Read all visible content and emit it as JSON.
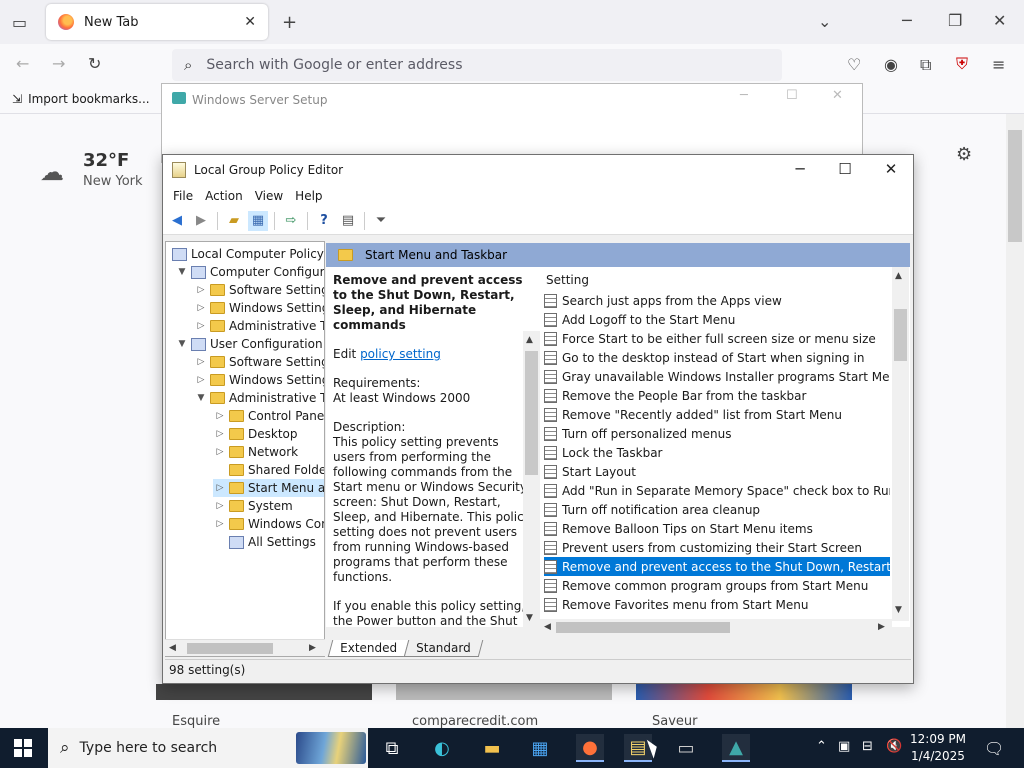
{
  "browser": {
    "tab_title": "New Tab",
    "url_placeholder": "Search with Google or enter address",
    "bookmark_import": "Import bookmarks...",
    "weather": {
      "temp": "32°F",
      "city": "New York"
    },
    "tiles": [
      "Esquire",
      "comparecredit.com",
      "Saveur"
    ]
  },
  "setup_window": {
    "title": "Windows Server Setup"
  },
  "gpe": {
    "title": "Local Group Policy Editor",
    "menu": [
      "File",
      "Action",
      "View",
      "Help"
    ],
    "tree": [
      {
        "label": "Local Computer Policy",
        "level": 0,
        "expander": "",
        "icon": "policy"
      },
      {
        "label": "Computer Configuration",
        "level": 1,
        "expander": "v",
        "icon": "computer"
      },
      {
        "label": "Software Settings",
        "level": 2,
        "expander": ">",
        "icon": "folder"
      },
      {
        "label": "Windows Settings",
        "level": 2,
        "expander": ">",
        "icon": "folder"
      },
      {
        "label": "Administrative Templates",
        "level": 2,
        "expander": ">",
        "icon": "folder"
      },
      {
        "label": "User Configuration",
        "level": 1,
        "expander": "v",
        "icon": "user"
      },
      {
        "label": "Software Settings",
        "level": 2,
        "expander": ">",
        "icon": "folder"
      },
      {
        "label": "Windows Settings",
        "level": 2,
        "expander": ">",
        "icon": "folder"
      },
      {
        "label": "Administrative Templates",
        "level": 2,
        "expander": "v",
        "icon": "folder"
      },
      {
        "label": "Control Panel",
        "level": 3,
        "expander": ">",
        "icon": "folder"
      },
      {
        "label": "Desktop",
        "level": 3,
        "expander": ">",
        "icon": "folder"
      },
      {
        "label": "Network",
        "level": 3,
        "expander": ">",
        "icon": "folder"
      },
      {
        "label": "Shared Folders",
        "level": 3,
        "expander": "",
        "icon": "folder"
      },
      {
        "label": "Start Menu and Taskbar",
        "level": 3,
        "expander": ">",
        "icon": "folder",
        "selected": true
      },
      {
        "label": "System",
        "level": 3,
        "expander": ">",
        "icon": "folder"
      },
      {
        "label": "Windows Components",
        "level": 3,
        "expander": ">",
        "icon": "folder"
      },
      {
        "label": "All Settings",
        "level": 3,
        "expander": "",
        "icon": "settings"
      }
    ],
    "pane_header": "Start Menu and Taskbar",
    "description": {
      "title": "Remove and prevent access to the Shut Down, Restart, Sleep, and Hibernate commands",
      "edit_prefix": "Edit ",
      "edit_link": "policy setting",
      "req_label": "Requirements:",
      "req_value": "At least Windows 2000",
      "desc_label": "Description:",
      "desc_text": "This policy setting prevents users from performing the following commands from the Start menu or Windows Security screen: Shut Down, Restart, Sleep, and Hibernate. This policy setting does not prevent users from running Windows-based programs that perform these functions.",
      "enable_text": "If you enable this policy setting, the Power button and the Shut Down, Restart, Sleep, and Hibernate commands are"
    },
    "list_header": "Setting",
    "settings": [
      "Search just apps from the Apps view",
      "Add Logoff to the Start Menu",
      "Force Start to be either full screen size or menu size",
      "Go to the desktop instead of Start when signing in",
      "Gray unavailable Windows Installer programs Start Menu sh...",
      "Remove the People Bar from the taskbar",
      "Remove \"Recently added\" list from Start Menu",
      "Turn off personalized menus",
      "Lock the Taskbar",
      "Start Layout",
      "Add \"Run in Separate Memory Space\" check box to Run dial...",
      "Turn off notification area cleanup",
      "Remove Balloon Tips on Start Menu items",
      "Prevent users from customizing their Start Screen",
      "Remove and prevent access to the Shut Down, Restart, Sleep...",
      "Remove common program groups from Start Menu",
      "Remove Favorites menu from Start Menu"
    ],
    "selected_index": 14,
    "tabs": [
      "Extended",
      "Standard"
    ],
    "status": "98 setting(s)"
  },
  "taskbar": {
    "search_placeholder": "Type here to search",
    "time": "12:09 PM",
    "date": "1/4/2025"
  }
}
